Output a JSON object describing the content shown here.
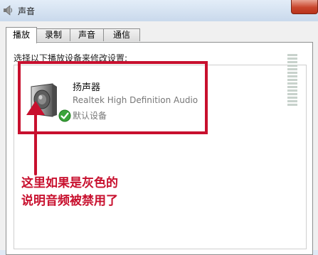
{
  "window": {
    "title": "声音",
    "icon": "speaker-icon"
  },
  "tabs": [
    {
      "label": "播放",
      "active": true
    },
    {
      "label": "录制",
      "active": false
    },
    {
      "label": "声音",
      "active": false
    },
    {
      "label": "通信",
      "active": false
    }
  ],
  "playback": {
    "instruction": "选择以下播放设备来修改设置:",
    "devices": [
      {
        "name": "扬声器",
        "description": "Realtek High Definition Audio",
        "status": "默认设备",
        "icon": "speaker-icon",
        "status_badge_icon": "green-check-icon"
      }
    ]
  },
  "annotation": {
    "line1": "这里如果是灰色的",
    "line2": "说明音频被禁用了",
    "color": "#c8102e"
  },
  "colors": {
    "accent_red": "#c8102e",
    "check_green": "#3aa43a"
  }
}
